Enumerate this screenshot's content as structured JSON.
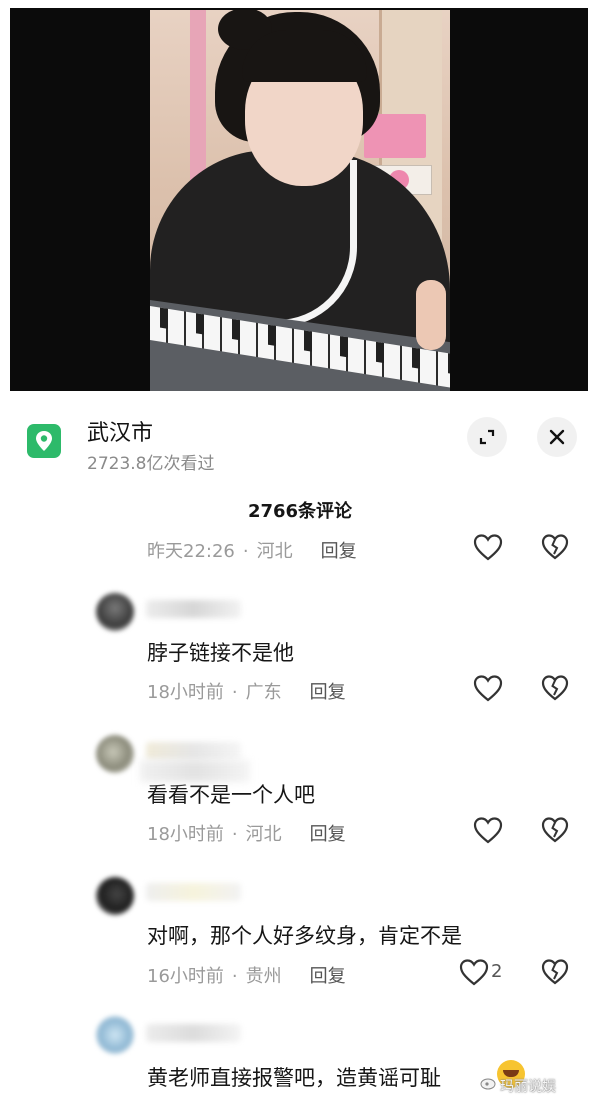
{
  "location": {
    "city": "武汉市",
    "views": "2723.8亿次看过"
  },
  "comments_header": {
    "count_label": "2766条评论"
  },
  "comments": [
    {
      "text": "",
      "time": "昨天22:26",
      "region": "河北",
      "reply_label": "回复",
      "likes": ""
    },
    {
      "text": "脖子链接不是他",
      "time": "18小时前",
      "region": "广东",
      "reply_label": "回复",
      "likes": ""
    },
    {
      "text": "看看不是一个人吧",
      "time": "18小时前",
      "region": "河北",
      "reply_label": "回复",
      "likes": ""
    },
    {
      "text": "对啊，那个人好多纹身，肯定不是",
      "time": "16小时前",
      "region": "贵州",
      "reply_label": "回复",
      "likes": "2"
    },
    {
      "text": "黄老师直接报警吧，造黄谣可耻",
      "time": "",
      "region": "",
      "reply_label": "",
      "likes": ""
    }
  ],
  "watermark": "玛丽说娱",
  "icons": {
    "location": "map-pin-icon",
    "expand": "expand-icon",
    "close": "close-icon",
    "like": "heart-icon",
    "dislike": "broken-heart-icon",
    "emoji": "laughing-crying-emoji"
  },
  "colors": {
    "location_badge": "#2dba6a",
    "meta_text": "#9a9a9a"
  }
}
